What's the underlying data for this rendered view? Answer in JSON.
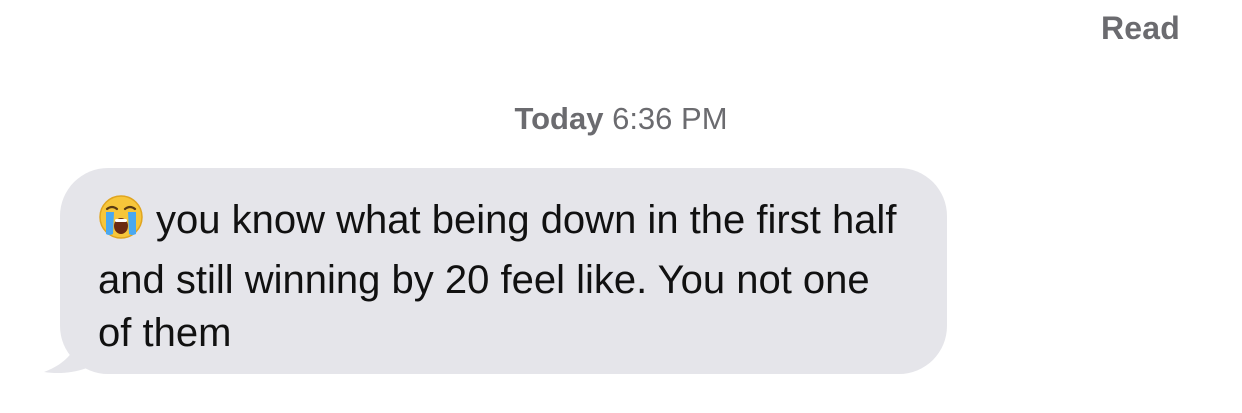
{
  "header": {
    "read_receipt": "Read"
  },
  "conversation": {
    "timestamp_day": "Today",
    "timestamp_time": "6:36 PM",
    "message": {
      "emoji_icon": "loudly-crying-face-icon",
      "text": "you know what being down in the first half and still winning by 20 feel like. You not one of them"
    }
  },
  "colors": {
    "bubble_gray": "#e5e5ea",
    "secondary_text": "#6b6b6f",
    "message_text": "#111111",
    "background": "#ffffff"
  }
}
